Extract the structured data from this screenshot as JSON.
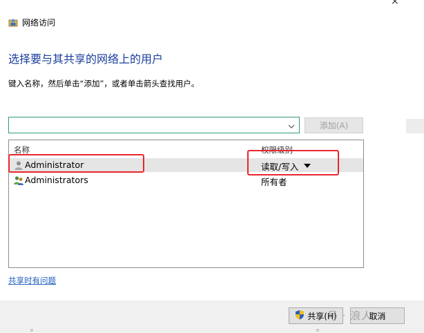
{
  "window": {
    "title": "网络访问",
    "close_glyph": "×"
  },
  "heading": "选择要与其共享的网络上的用户",
  "instruction": "键入名称，然后单击“添加”，或者单击箭头查找用户。",
  "name_input": {
    "value": "",
    "placeholder": ""
  },
  "add_button": {
    "label": "添加(A)"
  },
  "columns": {
    "name": "名称",
    "permission": "权限级别"
  },
  "rows": [
    {
      "name": "Administrator",
      "permission": "读取/写入",
      "selected": true
    },
    {
      "name": "Administrators",
      "permission": "所有者",
      "selected": false
    }
  ],
  "help_link": "共享时有问题",
  "share_button": {
    "label": "共享(H)"
  },
  "cancel_button": {
    "label": "取消"
  },
  "watermark": "号 · 浪人",
  "colors": {
    "heading": "#1a3e9c",
    "link": "#1f5dbf",
    "highlight": "#e8262b",
    "input_border": "#2f9a6e"
  }
}
